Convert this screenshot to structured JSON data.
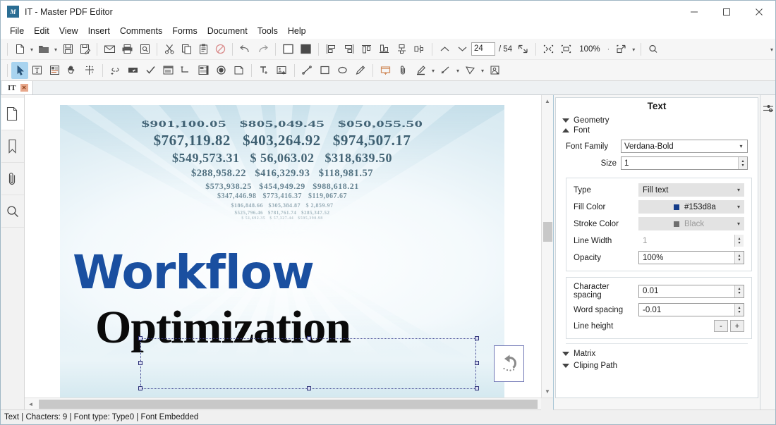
{
  "window": {
    "title": "IT - Master PDF Editor",
    "app_icon": "master-pdf-editor-icon",
    "minimize": "—",
    "maximize": "☐",
    "close": "✕"
  },
  "menubar": {
    "items": [
      {
        "label": "File"
      },
      {
        "label": "Edit"
      },
      {
        "label": "View"
      },
      {
        "label": "Insert"
      },
      {
        "label": "Comments"
      },
      {
        "label": "Forms"
      },
      {
        "label": "Document"
      },
      {
        "label": "Tools"
      },
      {
        "label": "Help"
      }
    ]
  },
  "toolbar_main": {
    "items": [
      {
        "name": "new-document-button",
        "icon": "new-page-icon"
      },
      {
        "name": "new-document-dropdown",
        "icon": "chevron-down-icon"
      },
      {
        "name": "open-document-button",
        "icon": "folder-open-icon"
      },
      {
        "name": "open-document-dropdown",
        "icon": "chevron-down-icon"
      },
      {
        "name": "save-button",
        "icon": "floppy-disk-icon"
      },
      {
        "name": "save-as-button",
        "icon": "floppy-disk-edit-icon"
      },
      {
        "name": "email-button",
        "icon": "envelope-icon"
      },
      {
        "name": "print-button",
        "icon": "printer-icon"
      },
      {
        "name": "print-preview-button",
        "icon": "print-preview-icon"
      },
      {
        "name": "cut-button",
        "icon": "scissors-icon"
      },
      {
        "name": "copy-button",
        "icon": "copy-icon"
      },
      {
        "name": "paste-button",
        "icon": "clipboard-icon"
      },
      {
        "name": "delete-button",
        "icon": "no-entry-icon"
      },
      {
        "name": "undo-button",
        "icon": "undo-arrow-icon"
      },
      {
        "name": "redo-button",
        "icon": "redo-arrow-icon"
      },
      {
        "name": "fill-none-button",
        "icon": "square-outline-icon"
      },
      {
        "name": "fill-solid-button",
        "icon": "square-filled-icon"
      },
      {
        "name": "align-left-button",
        "icon": "align-left-icon"
      },
      {
        "name": "align-right-button",
        "icon": "align-right-icon"
      },
      {
        "name": "align-top-button",
        "icon": "align-top-icon"
      },
      {
        "name": "align-bottom-button",
        "icon": "align-bottom-icon"
      },
      {
        "name": "center-horizontal-button",
        "icon": "center-horizontal-icon"
      },
      {
        "name": "center-vertical-button",
        "icon": "center-vertical-icon"
      },
      {
        "name": "previous-page-button",
        "icon": "chevron-up-icon"
      },
      {
        "name": "next-page-button",
        "icon": "chevron-down-icon"
      }
    ],
    "page_current": "24",
    "page_total": "/ 54",
    "fit_page": {
      "name": "fit-page-button",
      "icon": "fit-page-icon"
    },
    "fit_width": {
      "name": "fit-width-button",
      "icon": "fit-width-icon"
    },
    "zoom_level": "100%",
    "zoom_dot": "·",
    "zoom_expand": {
      "name": "zoom-selection-button",
      "icon": "zoom-selection-icon"
    },
    "zoom_dropdown": "▾",
    "search": {
      "name": "search-button",
      "icon": "search-icon"
    },
    "overflow": "▾"
  },
  "toolbar_tools": {
    "items": [
      {
        "name": "select-tool",
        "icon": "cursor-arrow-icon",
        "active": true
      },
      {
        "name": "edit-text-tool",
        "icon": "text-box-icon"
      },
      {
        "name": "edit-object-tool",
        "icon": "edit-object-icon"
      },
      {
        "name": "hand-tool",
        "icon": "hand-icon"
      },
      {
        "name": "crop-tool",
        "icon": "crop-icon"
      },
      {
        "name": "add-link-tool",
        "icon": "link-icon"
      },
      {
        "name": "text-field-tool",
        "icon": "text-field-icon"
      },
      {
        "name": "checkbox-tool",
        "icon": "checkmark-icon"
      },
      {
        "name": "combo-box-tool",
        "icon": "combo-box-icon"
      },
      {
        "name": "list-box-tool",
        "icon": "list-box-icon"
      },
      {
        "name": "radio-list-tool",
        "icon": "radio-list-icon"
      },
      {
        "name": "radio-button-tool",
        "icon": "radio-button-icon"
      },
      {
        "name": "button-tool",
        "icon": "push-button-icon"
      },
      {
        "name": "add-text-tool",
        "icon": "add-text-icon"
      },
      {
        "name": "add-image-tool",
        "icon": "add-image-icon"
      },
      {
        "name": "line-tool",
        "icon": "line-icon"
      },
      {
        "name": "rectangle-tool",
        "icon": "rectangle-icon"
      },
      {
        "name": "ellipse-tool",
        "icon": "ellipse-icon"
      },
      {
        "name": "pencil-tool",
        "icon": "pencil-icon"
      },
      {
        "name": "sticky-note-tool",
        "icon": "sticky-note-icon"
      },
      {
        "name": "attachment-tool",
        "icon": "paperclip-icon"
      },
      {
        "name": "highlight-tool",
        "icon": "highlighter-icon"
      },
      {
        "name": "highlight-dropdown",
        "icon": "chevron-down-icon"
      },
      {
        "name": "arrow-tool",
        "icon": "arrow-icon"
      },
      {
        "name": "arrow-dropdown",
        "icon": "chevron-down-icon"
      },
      {
        "name": "polygon-tool",
        "icon": "polygon-icon"
      },
      {
        "name": "polygon-dropdown",
        "icon": "chevron-down-icon"
      },
      {
        "name": "stamp-tool",
        "icon": "stamp-icon"
      }
    ]
  },
  "tabstrip": {
    "tab_label": "IT",
    "tab_close": "✕"
  },
  "left_rail": {
    "items": [
      {
        "name": "sidebar-item-pages",
        "icon": "page-thumbnail-icon",
        "active": true
      },
      {
        "name": "sidebar-item-bookmarks",
        "icon": "bookmark-icon",
        "active": false
      },
      {
        "name": "sidebar-item-attachments",
        "icon": "paperclip-icon",
        "active": false
      },
      {
        "name": "sidebar-item-search",
        "icon": "search-icon",
        "active": false
      }
    ]
  },
  "document": {
    "headline_blue": "Workflow",
    "headline_black": "Optimization",
    "rotate_handle_icon": "rotate-counterclockwise-icon",
    "background_numbers": [
      [
        "$901,100.05",
        "$805,049.45",
        "$050,055.50"
      ],
      [
        "$767,119.82",
        "$403,264.92",
        "$974,507.17"
      ],
      [
        "$549,573.31",
        "$ 56,063.02",
        "$318,639.50"
      ],
      [
        "$288,958.22",
        "$416,329.93",
        "$118,981.57"
      ],
      [
        "$573,938.25",
        "$454,949.29",
        "$988,618.21"
      ],
      [
        "$347,446.98",
        "$773,416.37",
        "$119,067.67"
      ],
      [
        "$186,848.66",
        "$305,384.87",
        "$  2,859.97"
      ],
      [
        "$525,796.46",
        "$781,761.74",
        "$285,347.52"
      ],
      [
        "$ 51,692.35",
        "$ 57,327.44",
        "$595,390.98"
      ]
    ]
  },
  "panel": {
    "title": "Text",
    "settings_icon": "sliders-icon",
    "sections": {
      "geometry": {
        "label": "Geometry",
        "state": "collapsed"
      },
      "font": {
        "label": "Font",
        "state": "expanded"
      },
      "matrix": {
        "label": "Matrix",
        "state": "collapsed"
      },
      "clipping_path": {
        "label": "Cliping Path",
        "state": "collapsed"
      }
    },
    "font": {
      "font_family_label": "Font Family",
      "font_family_value": "Verdana-Bold",
      "size_label": "Size",
      "size_value": "1",
      "type_label": "Type",
      "type_value": "Fill text",
      "fill_color_label": "Fill Color",
      "fill_color_value": "#153d8a",
      "fill_color_swatch": "#153d8a",
      "stroke_color_label": "Stroke Color",
      "stroke_color_value": "Black",
      "stroke_color_swatch": "#5a5a5a",
      "line_width_label": "Line Width",
      "line_width_value": "1",
      "opacity_label": "Opacity",
      "opacity_value": "100%",
      "character_spacing_label": "Character spacing",
      "character_spacing_value": "0.01",
      "word_spacing_label": "Word spacing",
      "word_spacing_value": "-0.01",
      "line_height_label": "Line height",
      "line_height_minus": "-",
      "line_height_plus": "+"
    }
  },
  "statusbar": {
    "text": "Text | Chacters: 9 | Font type: Type0 | Font Embedded"
  },
  "colors": {
    "accent_blue": "#1a4fa0",
    "selection_border": "#2b2f76",
    "panel_border": "#a9c6d6",
    "toolbar_bg": "#f6f6f6"
  }
}
